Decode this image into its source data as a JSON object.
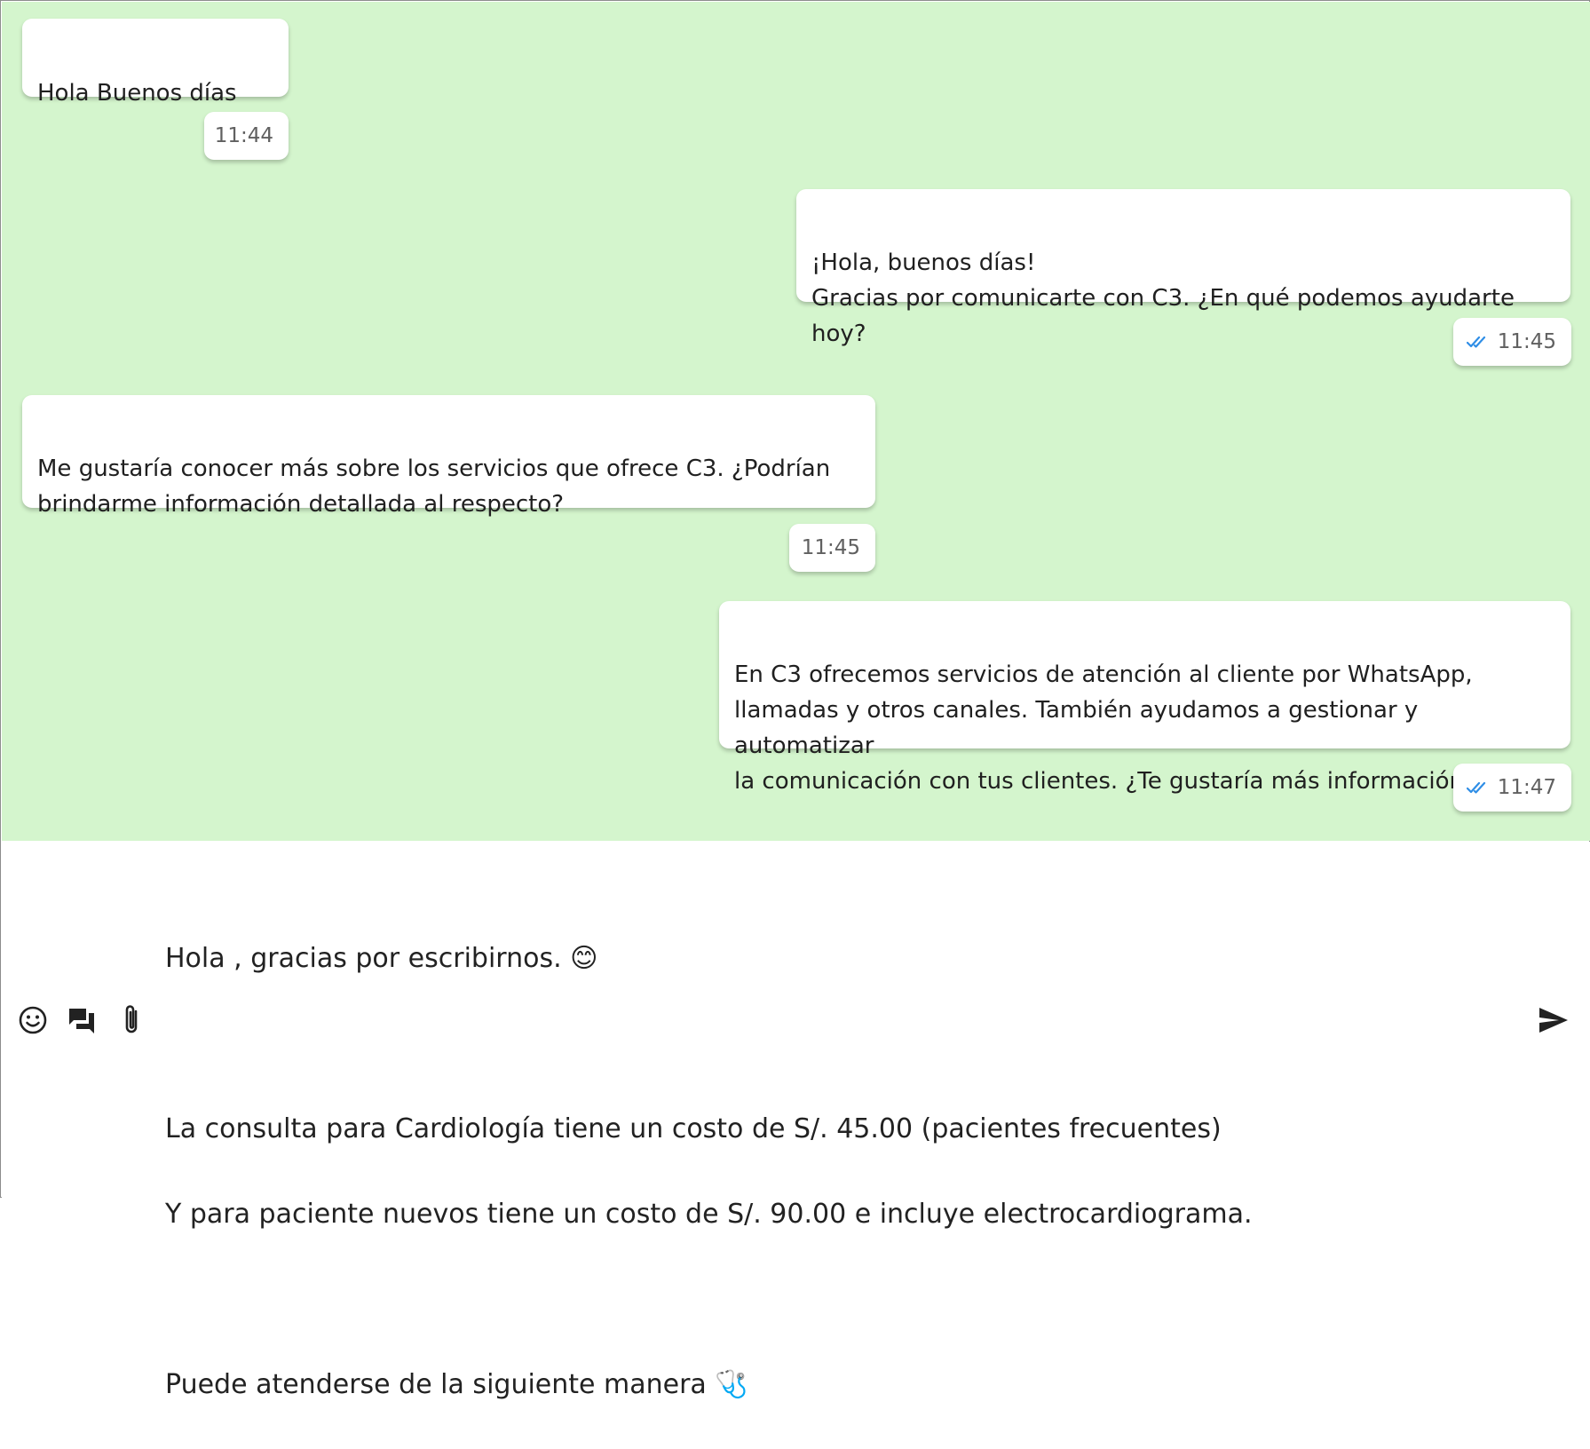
{
  "colors": {
    "chat_background": "#d4f5cd",
    "bubble_background": "#ffffff",
    "read_ticks": "#2f8ee6",
    "timestamp_text": "#606060"
  },
  "messages": [
    {
      "direction": "incoming",
      "text": "Hola Buenos días",
      "time": "11:44",
      "status_icon": ""
    },
    {
      "direction": "outgoing",
      "text": "¡Hola, buenos días!\nGracias por comunicarte con C3. ¿En qué podemos ayudarte hoy?",
      "time": "11:45",
      "status_icon": "double-check-icon"
    },
    {
      "direction": "incoming",
      "text": "Me gustaría conocer más sobre los servicios que ofrece C3. ¿Podrían\nbrindarme información detallada al respecto?",
      "time": "11:45",
      "status_icon": ""
    },
    {
      "direction": "outgoing",
      "text": "En C3 ofrecemos servicios de atención al cliente por WhatsApp,\nllamadas y otros canales. También ayudamos a gestionar y automatizar\nla comunicación con tus clientes. ¿Te gustaría más información?",
      "time": "11:47",
      "status_icon": "double-check-icon"
    }
  ],
  "composer": {
    "line_1": "Hola , gracias por escribirnos. 😊",
    "line_2": "La consulta para Cardiología tiene un costo de S/. 45.00 (pacientes frecuentes)",
    "line_3": "Y para paciente nuevos tiene un costo de S/. 90.00 e incluye electrocardiograma.",
    "line_4": "Puede atenderse de la siguiente manera 🩺",
    "icons": [
      "emoji-icon",
      "quick-replies-icon",
      "attach-icon",
      "send-icon"
    ]
  }
}
